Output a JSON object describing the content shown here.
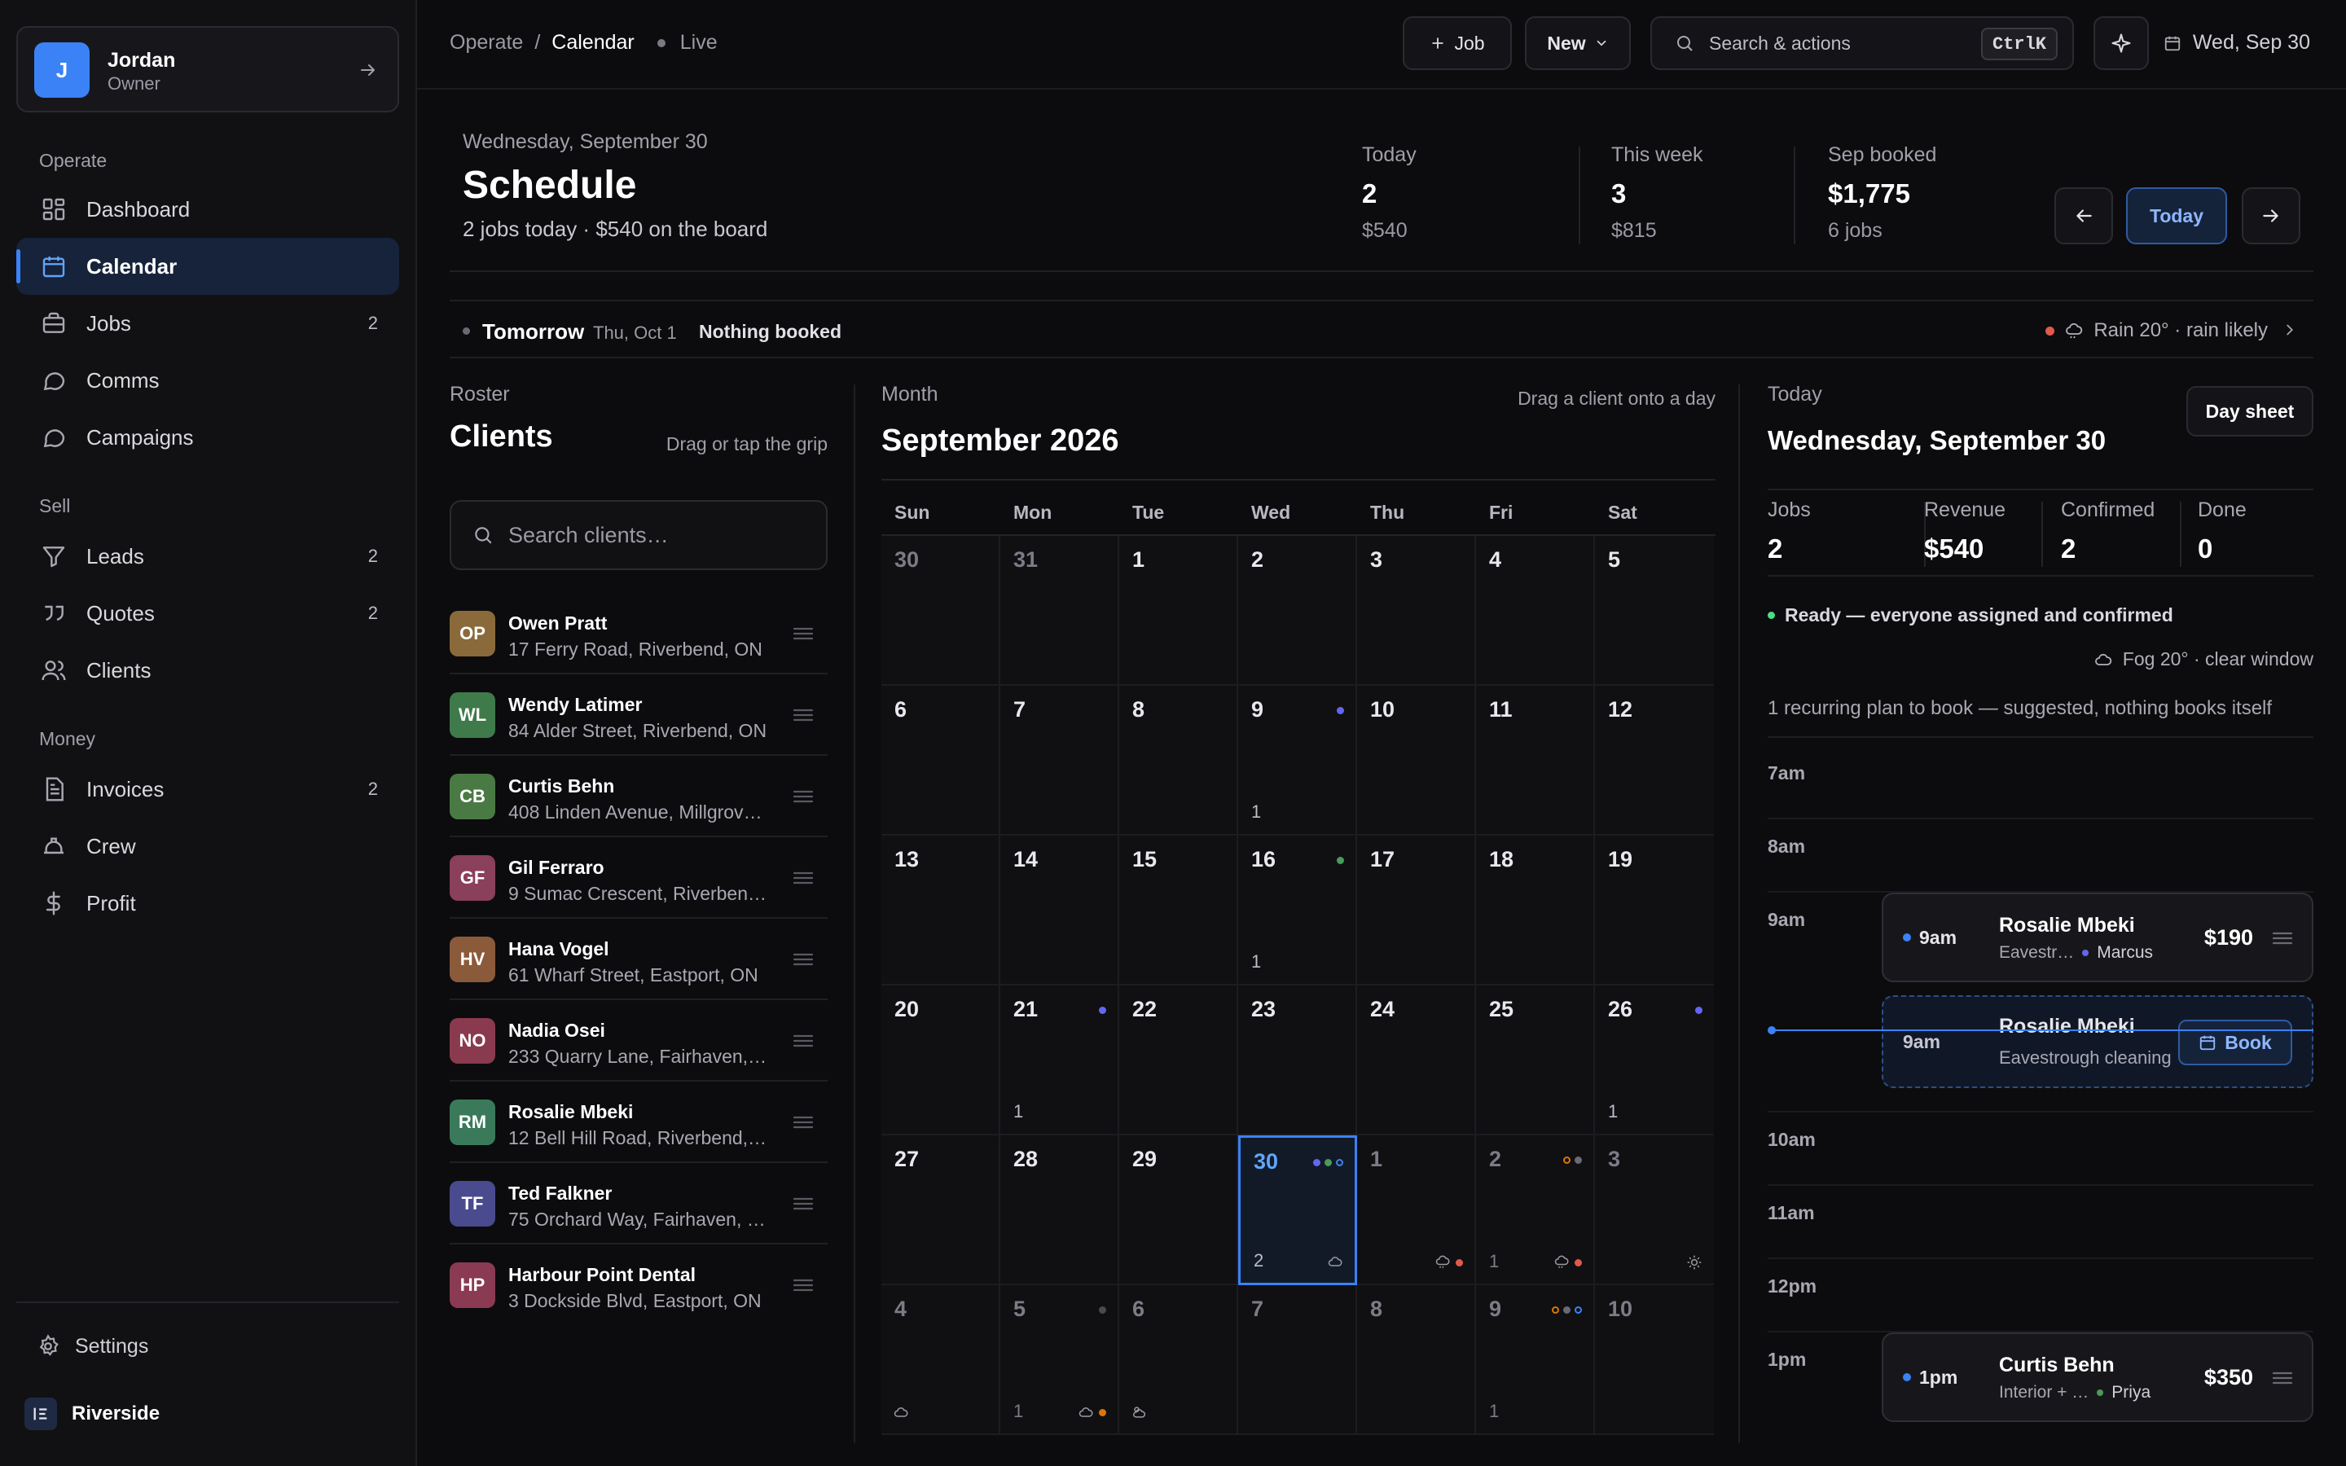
{
  "user": {
    "initial": "J",
    "name": "Jordan",
    "role": "Owner"
  },
  "nav": {
    "operate_label": "Operate",
    "sell_label": "Sell",
    "money_label": "Money",
    "dashboard": "Dashboard",
    "calendar": "Calendar",
    "jobs": "Jobs",
    "jobs_badge": "2",
    "comms": "Comms",
    "campaigns": "Campaigns",
    "leads": "Leads",
    "leads_badge": "2",
    "quotes": "Quotes",
    "quotes_badge": "2",
    "clients": "Clients",
    "invoices": "Invoices",
    "invoices_badge": "2",
    "crew": "Crew",
    "profit": "Profit",
    "settings": "Settings",
    "org": "Riverside"
  },
  "topbar": {
    "crumb_parent": "Operate",
    "crumb_sep": "/",
    "crumb_current": "Calendar",
    "live": "Live",
    "job_button": "Job",
    "new_button": "New",
    "search_placeholder": "Search & actions",
    "kbd": "CtrlK",
    "date": "Wed, Sep 30"
  },
  "summary": {
    "date": "Wednesday, September 30",
    "title": "Schedule",
    "subtitle": "2 jobs today · $540 on the board",
    "today_label": "Today",
    "today_value": "2",
    "today_sub": "$540",
    "week_label": "This week",
    "week_value": "3",
    "week_sub": "$815",
    "month_label": "Sep booked",
    "month_value": "$1,775",
    "month_sub": "6 jobs",
    "today_button": "Today"
  },
  "tomorrow": {
    "label": "Tomorrow",
    "date": "Thu, Oct 1",
    "status": "Nothing booked",
    "weather": "Rain 20° · rain likely"
  },
  "roster": {
    "eyebrow": "Roster",
    "title": "Clients",
    "hint": "Drag or tap the grip",
    "search_placeholder": "Search clients…",
    "clients": [
      {
        "initials": "OP",
        "name": "Owen Pratt",
        "address": "17 Ferry Road, Riverbend, ON",
        "color": "#8a6a3a"
      },
      {
        "initials": "WL",
        "name": "Wendy Latimer",
        "address": "84 Alder Street, Riverbend, ON",
        "color": "#3f7a4a"
      },
      {
        "initials": "CB",
        "name": "Curtis Behn",
        "address": "408 Linden Avenue, Millgrove, ON",
        "color": "#4a7a44"
      },
      {
        "initials": "GF",
        "name": "Gil Ferraro",
        "address": "9 Sumac Crescent, Riverbend, ON",
        "color": "#8a3f5a"
      },
      {
        "initials": "HV",
        "name": "Hana Vogel",
        "address": "61 Wharf Street, Eastport, ON",
        "color": "#8a5a3a"
      },
      {
        "initials": "NO",
        "name": "Nadia Osei",
        "address": "233 Quarry Lane, Fairhaven, ON",
        "color": "#8a3a4e"
      },
      {
        "initials": "RM",
        "name": "Rosalie Mbeki",
        "address": "12 Bell Hill Road, Riverbend, ON",
        "color": "#3a7a5a"
      },
      {
        "initials": "TF",
        "name": "Ted Falkner",
        "address": "75 Orchard Way, Fairhaven, ON",
        "color": "#4a4a8e"
      },
      {
        "initials": "HP",
        "name": "Harbour Point Dental",
        "address": "3 Dockside Blvd, Eastport, ON",
        "color": "#8a3a52"
      }
    ]
  },
  "month": {
    "eyebrow": "Month",
    "title": "September 2026",
    "hint": "Drag a client onto a day",
    "weekdays": [
      "Sun",
      "Mon",
      "Tue",
      "Wed",
      "Thu",
      "Fri",
      "Sat"
    ],
    "weeks": [
      [
        {
          "d": "30",
          "muted": true
        },
        {
          "d": "31",
          "muted": true
        },
        {
          "d": "1"
        },
        {
          "d": "2"
        },
        {
          "d": "3"
        },
        {
          "d": "4"
        },
        {
          "d": "5"
        }
      ],
      [
        {
          "d": "6"
        },
        {
          "d": "7"
        },
        {
          "d": "8"
        },
        {
          "d": "9",
          "count": "1",
          "dots": [
            {
              "c": "#6366f1"
            }
          ]
        },
        {
          "d": "10"
        },
        {
          "d": "11"
        },
        {
          "d": "12"
        }
      ],
      [
        {
          "d": "13"
        },
        {
          "d": "14"
        },
        {
          "d": "15"
        },
        {
          "d": "16",
          "count": "1",
          "dots": [
            {
              "c": "#4a9a5a"
            }
          ]
        },
        {
          "d": "17"
        },
        {
          "d": "18"
        },
        {
          "d": "19"
        }
      ],
      [
        {
          "d": "20"
        },
        {
          "d": "21",
          "count": "1",
          "dots": [
            {
              "c": "#6366f1"
            }
          ]
        },
        {
          "d": "22"
        },
        {
          "d": "23"
        },
        {
          "d": "24"
        },
        {
          "d": "25"
        },
        {
          "d": "26",
          "count": "1",
          "dots": [
            {
              "c": "#6366f1"
            }
          ]
        }
      ],
      [
        {
          "d": "27"
        },
        {
          "d": "28"
        },
        {
          "d": "29"
        },
        {
          "d": "30",
          "today": true,
          "count": "2",
          "dots": [
            {
              "c": "#6366f1"
            },
            {
              "c": "#4a9a5a"
            },
            {
              "c": "#3b82f6",
              "ring": true
            }
          ],
          "wx": "cloud-icon"
        },
        {
          "d": "1",
          "muted": true,
          "wx": "rain-icon",
          "wxdot": "#e05a4a"
        },
        {
          "d": "2",
          "muted": true,
          "count": "1",
          "dots": [
            {
              "c": "#d97706",
              "ring": true
            },
            {
              "c": "#6a6a74"
            }
          ],
          "wx": "rain-icon",
          "wxdot": "#e05a4a"
        },
        {
          "d": "3",
          "muted": true,
          "wx": "sun-icon"
        }
      ],
      [
        {
          "d": "4",
          "muted": true,
          "wxleft": "cloud-icon"
        },
        {
          "d": "5",
          "muted": true,
          "count": "1",
          "dots": [
            {
              "c": "#4a4a52"
            }
          ],
          "wx": "cloud-icon",
          "wxdot": "#d97706"
        },
        {
          "d": "6",
          "muted": true,
          "wxleft": "cloud-sun-icon"
        },
        {
          "d": "7",
          "muted": true
        },
        {
          "d": "8",
          "muted": true
        },
        {
          "d": "9",
          "muted": true,
          "count": "1",
          "dots": [
            {
              "c": "#d97706",
              "ring": true
            },
            {
              "c": "#6a6a74"
            },
            {
              "c": "#3b82f6",
              "ring": true
            }
          ]
        },
        {
          "d": "10",
          "muted": true
        }
      ]
    ]
  },
  "day": {
    "eyebrow": "Today",
    "title": "Wednesday, September 30",
    "day_sheet": "Day sheet",
    "jobs_label": "Jobs",
    "jobs_value": "2",
    "revenue_label": "Revenue",
    "revenue_value": "$540",
    "confirmed_label": "Confirmed",
    "confirmed_value": "2",
    "done_label": "Done",
    "done_value": "0",
    "ready": "Ready — everyone assigned and confirmed",
    "weather": "Fog 20° · clear window",
    "recurring": "1 recurring plan to book — suggested, nothing books itself",
    "hours": [
      "7am",
      "8am",
      "9am",
      "10am",
      "11am",
      "12pm",
      "1pm"
    ],
    "job1": {
      "time": "9am",
      "name": "Rosalie Mbeki",
      "service": "Eavestr…",
      "crew": "Marcus",
      "crew_color": "#6366f1",
      "amount": "$190"
    },
    "suggestion": {
      "time": "9am",
      "name": "Rosalie Mbeki",
      "service": "Eavestrough cleaning",
      "button": "Book"
    },
    "job2": {
      "time": "1pm",
      "name": "Curtis Behn",
      "service": "Interior + …",
      "crew": "Priya",
      "crew_color": "#4a9a5a",
      "amount": "$350"
    }
  }
}
